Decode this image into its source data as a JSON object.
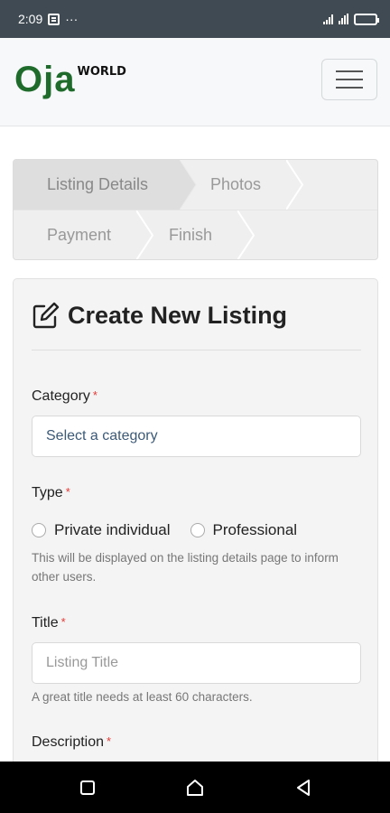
{
  "status_bar": {
    "time": "2:09",
    "dots": "···",
    "icons": [
      "notification-icon",
      "signal-icon",
      "wifi-signal-icon",
      "battery-icon"
    ]
  },
  "header": {
    "logo_main": "Oja",
    "logo_sup": "WORLD",
    "menu_icon": "hamburger-menu-icon"
  },
  "steps": [
    {
      "label": "Listing Details",
      "active": true
    },
    {
      "label": "Photos",
      "active": false
    },
    {
      "label": "Payment",
      "active": false
    },
    {
      "label": "Finish",
      "active": false
    }
  ],
  "form": {
    "title": "Create New Listing",
    "title_icon": "edit-icon",
    "category": {
      "label": "Category",
      "required_mark": "*",
      "value": "Select a category"
    },
    "type": {
      "label": "Type",
      "required_mark": "*",
      "options": [
        "Private individual",
        "Professional"
      ],
      "help": "This will be displayed on the listing details page to inform other users."
    },
    "title_field": {
      "label": "Title",
      "required_mark": "*",
      "placeholder": "Listing Title",
      "help": "A great title needs at least 60 characters."
    },
    "description": {
      "label": "Description",
      "required_mark": "*"
    }
  },
  "nav_bar": {
    "buttons": [
      "recent-apps-icon",
      "home-icon",
      "back-icon"
    ]
  },
  "colors": {
    "brand_green": "#1f6b2c",
    "required_red": "#e53935",
    "status_bar": "#3f4a53"
  }
}
